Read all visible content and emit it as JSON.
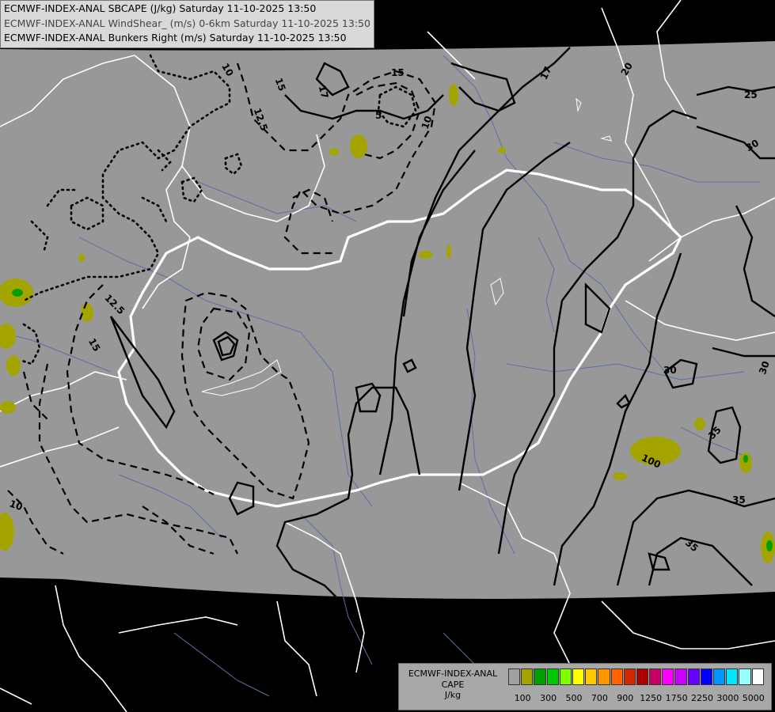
{
  "header": {
    "line1": "ECMWF-INDEX-ANAL SBCAPE (J/kg) Saturday 11-10-2025 13:50",
    "line2": "ECMWF-INDEX-ANAL WindShear_ (m/s) 0-6km Saturday 11-10-2025 13:50",
    "line3": "ECMWF-INDEX-ANAL Bunkers Right (m/s) Saturday 11-10-2025 13:50"
  },
  "legend": {
    "title_line1": "ECMWF-INDEX-ANAL",
    "title_line2": "CAPE",
    "title_line3": "J/kg",
    "colors": [
      "#a0a0a0",
      "#a4a400",
      "#00a000",
      "#00c800",
      "#80ff00",
      "#ffff00",
      "#ffc800",
      "#ff9600",
      "#ff6400",
      "#d22800",
      "#aa0000",
      "#c80064",
      "#ff00ff",
      "#c800ff",
      "#6400ff",
      "#0000ff",
      "#0096ff",
      "#00e6ff",
      "#96ffff",
      "#ffffff"
    ],
    "ticks": [
      "100",
      "300",
      "500",
      "700",
      "900",
      "1250",
      "1750",
      "2250",
      "3000",
      "5000"
    ]
  },
  "contour_labels": [
    "10",
    "15",
    "17",
    "15",
    "5",
    "10",
    "12.5",
    "17",
    "20",
    "25",
    "30",
    "30",
    "30",
    "35",
    "35",
    "35",
    "12.5",
    "15",
    "10",
    "100"
  ],
  "colors": {
    "field": "#989898",
    "nodata": "#000000",
    "borders": "#ffffff",
    "rivers": "#5a6fa8",
    "contours": "#000000",
    "cape_low": "#a4a400",
    "cape_mid": "#00a000"
  }
}
